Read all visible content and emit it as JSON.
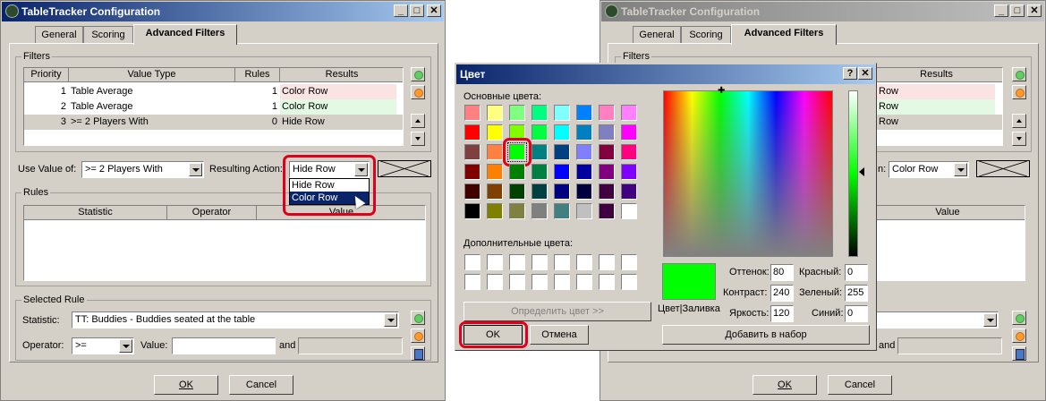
{
  "app": {
    "title": "TableTracker Configuration",
    "tabs": [
      "General",
      "Scoring",
      "Advanced Filters"
    ],
    "filters_label": "Filters",
    "filters_columns": [
      "Priority",
      "Value Type",
      "Rules",
      "Results"
    ],
    "filters_rows": [
      {
        "priority": "1",
        "value_type": "Table Average",
        "rules": "1",
        "results": "Color Row",
        "color": "#f9e3e3"
      },
      {
        "priority": "2",
        "value_type": "Table Average",
        "rules": "1",
        "results": "Color Row",
        "color": "#e3f9e3"
      },
      {
        "priority": "3",
        "value_type": ">= 2 Players With",
        "rules": "0",
        "results": "Hide Row",
        "color": "#d4d0c8"
      }
    ],
    "use_value_label": "Use Value of:",
    "use_value": ">= 2 Players With",
    "resulting_action_label": "Resulting Action:",
    "resulting_action": "Hide Row",
    "action_options": [
      "Hide Row",
      "Color Row"
    ],
    "rules_label": "Rules",
    "rules_columns": [
      "Statistic",
      "Operator",
      "Value"
    ],
    "selected_rule_label": "Selected Rule",
    "statistic_label": "Statistic:",
    "statistic_value": "TT: Buddies - Buddies seated at the table",
    "operator_label": "Operator:",
    "operator_value": ">=",
    "value_label": "Value:",
    "value_value": "",
    "and_label": "and",
    "ok": "OK",
    "cancel": "Cancel"
  },
  "right_app": {
    "title": "TableTracker Configuration",
    "tabs": [
      "General",
      "Scoring",
      "Advanced Filters"
    ],
    "filters_label": "Filters",
    "results_header": "Results",
    "results": [
      "Row",
      "Row",
      "Row"
    ],
    "action_label_tail": "n:",
    "action_value": "Color Row",
    "value_header": "Value",
    "and_label": "and",
    "ok": "OK",
    "cancel": "Cancel"
  },
  "color_dialog": {
    "title": "Цвет",
    "help": "?",
    "basic_label": "Основные цвета:",
    "custom_label": "Дополнительные цвета:",
    "define_button": "Определить цвет >>",
    "ok": "OK",
    "cancel": "Отмена",
    "hue_label": "Оттенок:",
    "hue": "80",
    "sat_label": "Контраст:",
    "sat": "240",
    "lum_label": "Яркость:",
    "lum": "120",
    "red_label": "Красный:",
    "red": "0",
    "green_label": "Зеленый:",
    "green": "255",
    "blue_label": "Синий:",
    "blue": "0",
    "solid_label": "Цвет|Заливка",
    "add_button": "Добавить в набор",
    "selected_color": "#00ff00",
    "basic_colors": [
      "#ff8080",
      "#ffff80",
      "#80ff80",
      "#00ff80",
      "#80ffff",
      "#0080ff",
      "#ff80c0",
      "#ff80ff",
      "#ff0000",
      "#ffff00",
      "#80ff00",
      "#00ff40",
      "#00ffff",
      "#0080c0",
      "#8080c0",
      "#ff00ff",
      "#804040",
      "#ff8040",
      "#00ff00",
      "#008080",
      "#004080",
      "#8080ff",
      "#800040",
      "#ff0080",
      "#800000",
      "#ff8000",
      "#008000",
      "#008040",
      "#0000ff",
      "#0000a0",
      "#800080",
      "#8000ff",
      "#400000",
      "#804000",
      "#004000",
      "#004040",
      "#000080",
      "#000040",
      "#400040",
      "#400080",
      "#000000",
      "#808000",
      "#808040",
      "#808080",
      "#408080",
      "#c0c0c0",
      "#400040",
      "#ffffff"
    ]
  },
  "accent": {
    "highlight": "#e0001a",
    "titlebar": "#0a246a"
  }
}
